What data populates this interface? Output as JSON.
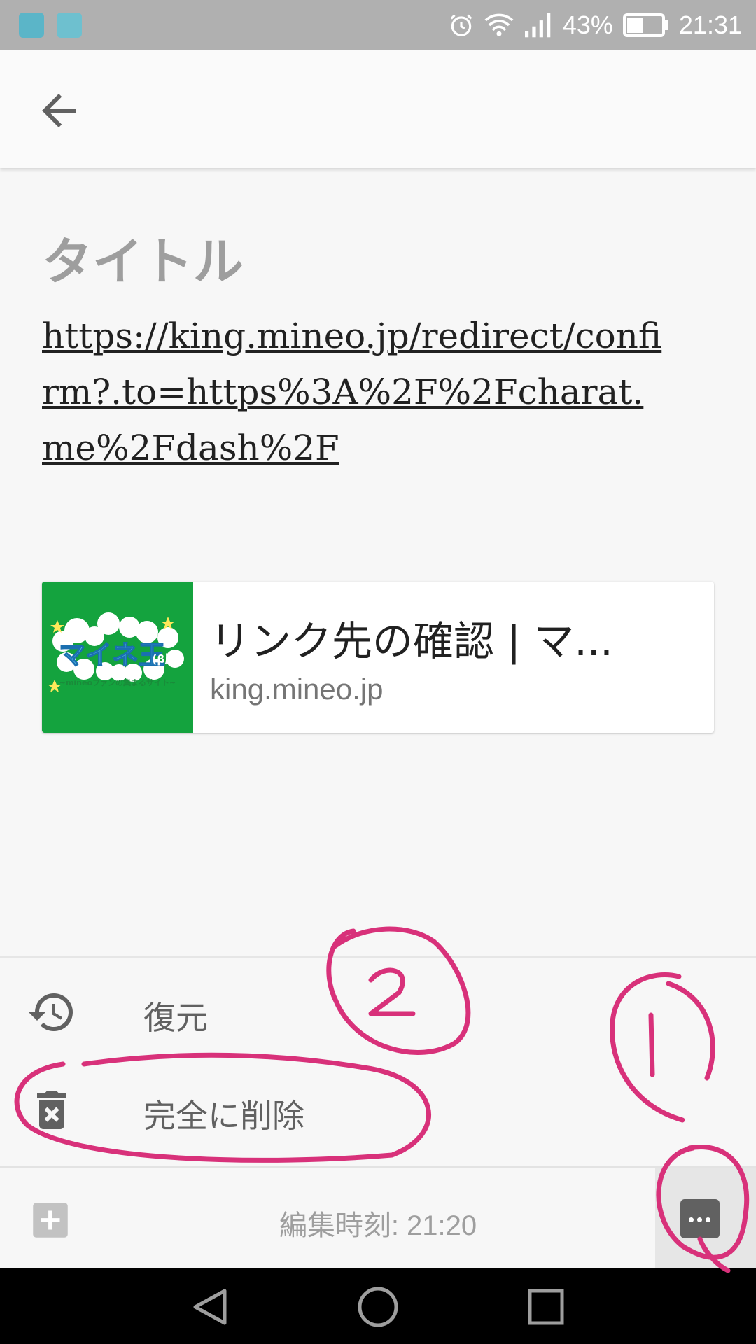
{
  "status_bar": {
    "battery": "43%",
    "time": "21:31",
    "icons": [
      "lala-app-icon",
      "gallery-app-icon",
      "alarm-icon",
      "wifi-icon",
      "signal-icon",
      "battery-icon"
    ]
  },
  "note": {
    "title": "タイトル",
    "link_text": "https://king.mineo.jp/redirect/confirm?.to=https%3A%2F%2Fcharat.me%2Fdash%2F",
    "card": {
      "title": "リンク先の確認 | マ...",
      "domain": "king.mineo.jp",
      "thumb_logo_text": "マイネ王",
      "thumb_beta_text": "(β版)",
      "thumb_sub_text": "~mineoファンの集まるサイト~"
    }
  },
  "menu": {
    "items": [
      {
        "label": "復元",
        "icon": "restore-history-icon"
      },
      {
        "label": "完全に削除",
        "icon": "delete-forever-icon"
      }
    ]
  },
  "toolbar": {
    "edit_time": "編集時刻: 21:20",
    "add_icon": "add-box-icon",
    "more_icon": "more-horiz-icon"
  },
  "annotations": {
    "circle_1": "1",
    "circle_2": "2",
    "color": "#d8317a"
  },
  "colors": {
    "status_bar": "#b0b0b0",
    "background": "#f7f7f7",
    "thumb_green": "#14a33e"
  }
}
